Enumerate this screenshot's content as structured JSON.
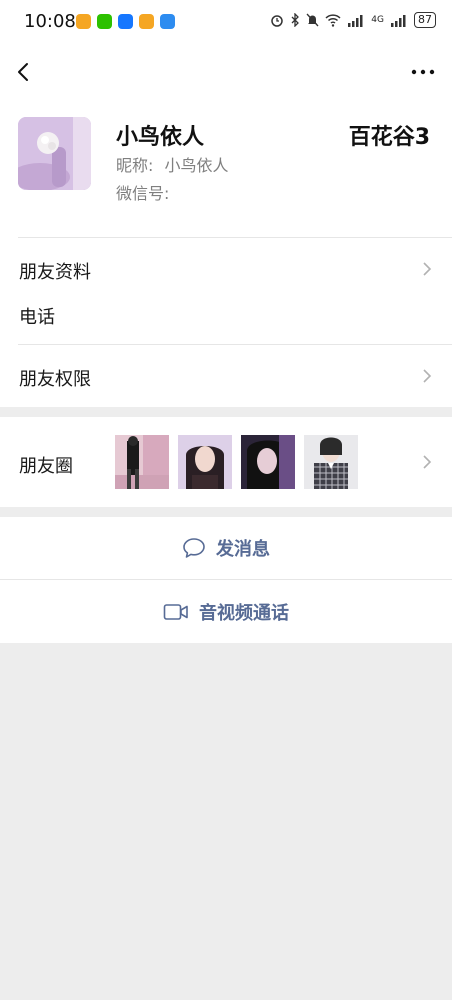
{
  "status_bar": {
    "time": "10:08",
    "battery": "87",
    "network": "4G"
  },
  "profile": {
    "name": "小鸟依人",
    "remark": "百花谷3",
    "nickname_label": "昵称:",
    "nickname": "小鸟依人",
    "wxid_label": "微信号:"
  },
  "rows": {
    "friend_info": "朋友资料",
    "phone": "电话",
    "permissions": "朋友权限",
    "moments": "朋友圈"
  },
  "actions": {
    "message": "发消息",
    "call": "音视频通话"
  },
  "colors": {
    "link": "#576b95",
    "background": "#ededed"
  }
}
